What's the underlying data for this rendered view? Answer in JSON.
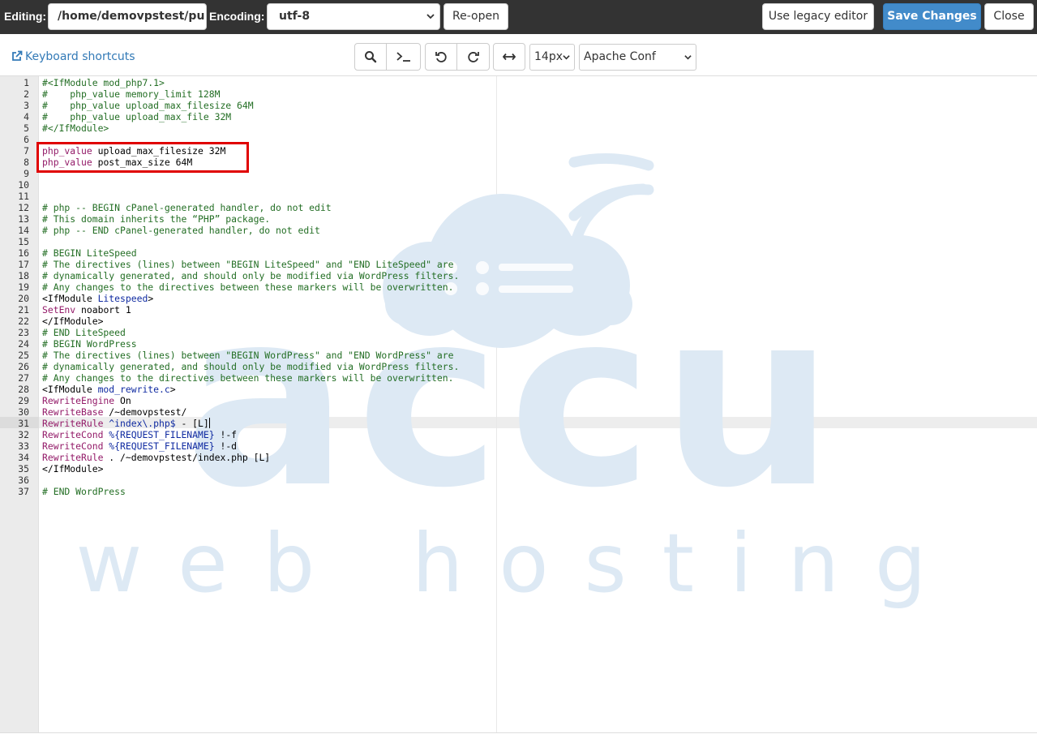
{
  "topbar": {
    "editing_label": "Editing:",
    "path_value": "/home/demovpstest/pu",
    "encoding_label": "Encoding:",
    "encoding_value": "utf-8",
    "reopen_label": "Re-open",
    "legacy_label": "Use legacy editor",
    "save_label": "Save Changes",
    "close_label": "Close"
  },
  "toolbar": {
    "shortcuts_label": "Keyboard shortcuts",
    "font_size": "14px",
    "mode": "Apache Conf"
  },
  "watermark": {
    "brand": "accu",
    "tagline": "web hosting"
  },
  "editor": {
    "cursor_line": 31,
    "lines": [
      {
        "n": "1",
        "segs": [
          [
            "c",
            "#<IfModule mod_php7.1>"
          ]
        ]
      },
      {
        "n": "2",
        "segs": [
          [
            "c",
            "#    php_value memory_limit 128M"
          ]
        ]
      },
      {
        "n": "3",
        "segs": [
          [
            "c",
            "#    php_value upload_max_filesize 64M"
          ]
        ]
      },
      {
        "n": "4",
        "segs": [
          [
            "c",
            "#    php_value upload_max_file 32M"
          ]
        ]
      },
      {
        "n": "5",
        "segs": [
          [
            "c",
            "#</IfModule>"
          ]
        ]
      },
      {
        "n": "6",
        "segs": []
      },
      {
        "n": "7",
        "segs": [
          [
            "k",
            "php_value"
          ],
          [
            "v",
            " upload_max_filesize 32M"
          ]
        ]
      },
      {
        "n": "8",
        "segs": [
          [
            "k",
            "php_value"
          ],
          [
            "v",
            " post_max_size 64M"
          ]
        ]
      },
      {
        "n": "9",
        "segs": []
      },
      {
        "n": "10",
        "segs": []
      },
      {
        "n": "11",
        "segs": []
      },
      {
        "n": "12",
        "segs": [
          [
            "c",
            "# php -- BEGIN cPanel-generated handler, do not edit"
          ]
        ]
      },
      {
        "n": "13",
        "segs": [
          [
            "c",
            "# This domain inherits the “PHP” package."
          ]
        ]
      },
      {
        "n": "14",
        "segs": [
          [
            "c",
            "# php -- END cPanel-generated handler, do not edit"
          ]
        ]
      },
      {
        "n": "15",
        "segs": []
      },
      {
        "n": "16",
        "segs": [
          [
            "c",
            "# BEGIN LiteSpeed"
          ]
        ]
      },
      {
        "n": "17",
        "segs": [
          [
            "c",
            "# The directives (lines) between \"BEGIN LiteSpeed\" and \"END LiteSpeed\" are"
          ]
        ]
      },
      {
        "n": "18",
        "segs": [
          [
            "c",
            "# dynamically generated, and should only be modified via WordPress filters."
          ]
        ]
      },
      {
        "n": "19",
        "segs": [
          [
            "c",
            "# Any changes to the directives between these markers will be overwritten."
          ]
        ]
      },
      {
        "n": "20",
        "segs": [
          [
            "t",
            "<IfModule "
          ],
          [
            "r",
            "Litespeed"
          ],
          [
            "t",
            ">"
          ]
        ]
      },
      {
        "n": "21",
        "segs": [
          [
            "k",
            "SetEnv"
          ],
          [
            "v",
            " noabort 1"
          ]
        ]
      },
      {
        "n": "22",
        "segs": [
          [
            "t",
            "</IfModule>"
          ]
        ]
      },
      {
        "n": "23",
        "segs": [
          [
            "c",
            "# END LiteSpeed"
          ]
        ]
      },
      {
        "n": "24",
        "segs": [
          [
            "c",
            "# BEGIN WordPress"
          ]
        ]
      },
      {
        "n": "25",
        "segs": [
          [
            "c",
            "# The directives (lines) between \"BEGIN WordPress\" and \"END WordPress\" are"
          ]
        ]
      },
      {
        "n": "26",
        "segs": [
          [
            "c",
            "# dynamically generated, and should only be modified via WordPress filters."
          ]
        ]
      },
      {
        "n": "27",
        "segs": [
          [
            "c",
            "# Any changes to the directives between these markers will be overwritten."
          ]
        ]
      },
      {
        "n": "28",
        "segs": [
          [
            "t",
            "<IfModule "
          ],
          [
            "r",
            "mod_rewrite.c"
          ],
          [
            "t",
            ">"
          ]
        ]
      },
      {
        "n": "29",
        "segs": [
          [
            "k",
            "RewriteEngine"
          ],
          [
            "v",
            " On"
          ]
        ]
      },
      {
        "n": "30",
        "segs": [
          [
            "k",
            "RewriteBase"
          ],
          [
            "v",
            " /~demovpstest/"
          ]
        ]
      },
      {
        "n": "31",
        "segs": [
          [
            "k",
            "RewriteRule"
          ],
          [
            "v",
            " "
          ],
          [
            "r",
            "^index\\.php$"
          ],
          [
            "v",
            " - [L]"
          ]
        ]
      },
      {
        "n": "32",
        "segs": [
          [
            "k",
            "RewriteCond"
          ],
          [
            "v",
            " "
          ],
          [
            "r",
            "%{REQUEST_FILENAME}"
          ],
          [
            "v",
            " !-f"
          ]
        ]
      },
      {
        "n": "33",
        "segs": [
          [
            "k",
            "RewriteCond"
          ],
          [
            "v",
            " "
          ],
          [
            "r",
            "%{REQUEST_FILENAME}"
          ],
          [
            "v",
            " !-d"
          ]
        ]
      },
      {
        "n": "34",
        "segs": [
          [
            "k",
            "RewriteRule"
          ],
          [
            "v",
            " . /~demovpstest/index.php [L]"
          ]
        ]
      },
      {
        "n": "35",
        "segs": [
          [
            "t",
            "</IfModule>"
          ]
        ]
      },
      {
        "n": "36",
        "segs": []
      },
      {
        "n": "37",
        "segs": [
          [
            "c",
            "# END WordPress"
          ]
        ]
      }
    ]
  },
  "colors": {
    "topbar_bg": "#333333",
    "primary": "#428bca",
    "comment": "#236e24",
    "keyword": "#931a68",
    "regex": "#0f2aa1",
    "highlight_box": "#e00000",
    "watermark": "#dde9f4"
  }
}
